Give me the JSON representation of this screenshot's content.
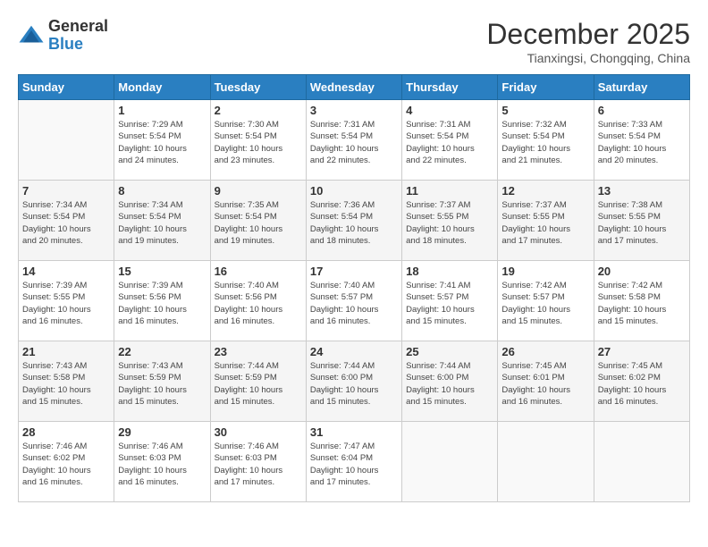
{
  "logo": {
    "general": "General",
    "blue": "Blue"
  },
  "title": {
    "month_year": "December 2025",
    "location": "Tianxingsi, Chongqing, China"
  },
  "days_of_week": [
    "Sunday",
    "Monday",
    "Tuesday",
    "Wednesday",
    "Thursday",
    "Friday",
    "Saturday"
  ],
  "weeks": [
    [
      {
        "day": "",
        "info": ""
      },
      {
        "day": "1",
        "info": "Sunrise: 7:29 AM\nSunset: 5:54 PM\nDaylight: 10 hours\nand 24 minutes."
      },
      {
        "day": "2",
        "info": "Sunrise: 7:30 AM\nSunset: 5:54 PM\nDaylight: 10 hours\nand 23 minutes."
      },
      {
        "day": "3",
        "info": "Sunrise: 7:31 AM\nSunset: 5:54 PM\nDaylight: 10 hours\nand 22 minutes."
      },
      {
        "day": "4",
        "info": "Sunrise: 7:31 AM\nSunset: 5:54 PM\nDaylight: 10 hours\nand 22 minutes."
      },
      {
        "day": "5",
        "info": "Sunrise: 7:32 AM\nSunset: 5:54 PM\nDaylight: 10 hours\nand 21 minutes."
      },
      {
        "day": "6",
        "info": "Sunrise: 7:33 AM\nSunset: 5:54 PM\nDaylight: 10 hours\nand 20 minutes."
      }
    ],
    [
      {
        "day": "7",
        "info": "Sunrise: 7:34 AM\nSunset: 5:54 PM\nDaylight: 10 hours\nand 20 minutes."
      },
      {
        "day": "8",
        "info": "Sunrise: 7:34 AM\nSunset: 5:54 PM\nDaylight: 10 hours\nand 19 minutes."
      },
      {
        "day": "9",
        "info": "Sunrise: 7:35 AM\nSunset: 5:54 PM\nDaylight: 10 hours\nand 19 minutes."
      },
      {
        "day": "10",
        "info": "Sunrise: 7:36 AM\nSunset: 5:54 PM\nDaylight: 10 hours\nand 18 minutes."
      },
      {
        "day": "11",
        "info": "Sunrise: 7:37 AM\nSunset: 5:55 PM\nDaylight: 10 hours\nand 18 minutes."
      },
      {
        "day": "12",
        "info": "Sunrise: 7:37 AM\nSunset: 5:55 PM\nDaylight: 10 hours\nand 17 minutes."
      },
      {
        "day": "13",
        "info": "Sunrise: 7:38 AM\nSunset: 5:55 PM\nDaylight: 10 hours\nand 17 minutes."
      }
    ],
    [
      {
        "day": "14",
        "info": "Sunrise: 7:39 AM\nSunset: 5:55 PM\nDaylight: 10 hours\nand 16 minutes."
      },
      {
        "day": "15",
        "info": "Sunrise: 7:39 AM\nSunset: 5:56 PM\nDaylight: 10 hours\nand 16 minutes."
      },
      {
        "day": "16",
        "info": "Sunrise: 7:40 AM\nSunset: 5:56 PM\nDaylight: 10 hours\nand 16 minutes."
      },
      {
        "day": "17",
        "info": "Sunrise: 7:40 AM\nSunset: 5:57 PM\nDaylight: 10 hours\nand 16 minutes."
      },
      {
        "day": "18",
        "info": "Sunrise: 7:41 AM\nSunset: 5:57 PM\nDaylight: 10 hours\nand 15 minutes."
      },
      {
        "day": "19",
        "info": "Sunrise: 7:42 AM\nSunset: 5:57 PM\nDaylight: 10 hours\nand 15 minutes."
      },
      {
        "day": "20",
        "info": "Sunrise: 7:42 AM\nSunset: 5:58 PM\nDaylight: 10 hours\nand 15 minutes."
      }
    ],
    [
      {
        "day": "21",
        "info": "Sunrise: 7:43 AM\nSunset: 5:58 PM\nDaylight: 10 hours\nand 15 minutes."
      },
      {
        "day": "22",
        "info": "Sunrise: 7:43 AM\nSunset: 5:59 PM\nDaylight: 10 hours\nand 15 minutes."
      },
      {
        "day": "23",
        "info": "Sunrise: 7:44 AM\nSunset: 5:59 PM\nDaylight: 10 hours\nand 15 minutes."
      },
      {
        "day": "24",
        "info": "Sunrise: 7:44 AM\nSunset: 6:00 PM\nDaylight: 10 hours\nand 15 minutes."
      },
      {
        "day": "25",
        "info": "Sunrise: 7:44 AM\nSunset: 6:00 PM\nDaylight: 10 hours\nand 15 minutes."
      },
      {
        "day": "26",
        "info": "Sunrise: 7:45 AM\nSunset: 6:01 PM\nDaylight: 10 hours\nand 16 minutes."
      },
      {
        "day": "27",
        "info": "Sunrise: 7:45 AM\nSunset: 6:02 PM\nDaylight: 10 hours\nand 16 minutes."
      }
    ],
    [
      {
        "day": "28",
        "info": "Sunrise: 7:46 AM\nSunset: 6:02 PM\nDaylight: 10 hours\nand 16 minutes."
      },
      {
        "day": "29",
        "info": "Sunrise: 7:46 AM\nSunset: 6:03 PM\nDaylight: 10 hours\nand 16 minutes."
      },
      {
        "day": "30",
        "info": "Sunrise: 7:46 AM\nSunset: 6:03 PM\nDaylight: 10 hours\nand 17 minutes."
      },
      {
        "day": "31",
        "info": "Sunrise: 7:47 AM\nSunset: 6:04 PM\nDaylight: 10 hours\nand 17 minutes."
      },
      {
        "day": "",
        "info": ""
      },
      {
        "day": "",
        "info": ""
      },
      {
        "day": "",
        "info": ""
      }
    ]
  ]
}
